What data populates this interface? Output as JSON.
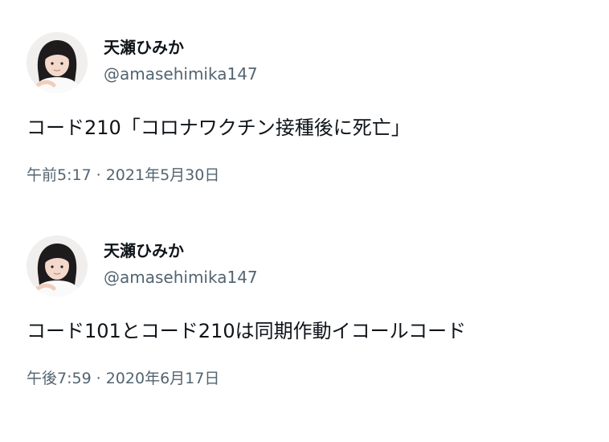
{
  "tweets": [
    {
      "display_name": "天瀬ひみか",
      "handle": "@amasehimika147",
      "text": "コード210「コロナワクチン接種後に死亡」",
      "time": "午前5:17",
      "separator": "·",
      "date": "2021年5月30日",
      "avatar_icon": "profile-photo"
    },
    {
      "display_name": "天瀬ひみか",
      "handle": "@amasehimika147",
      "text": "コード101とコード210は同期作動イコールコード",
      "time": "午後7:59",
      "separator": "·",
      "date": "2020年6月17日",
      "avatar_icon": "profile-photo"
    }
  ],
  "colors": {
    "text_primary": "#0f1419",
    "text_secondary": "#536471",
    "background": "#ffffff"
  }
}
